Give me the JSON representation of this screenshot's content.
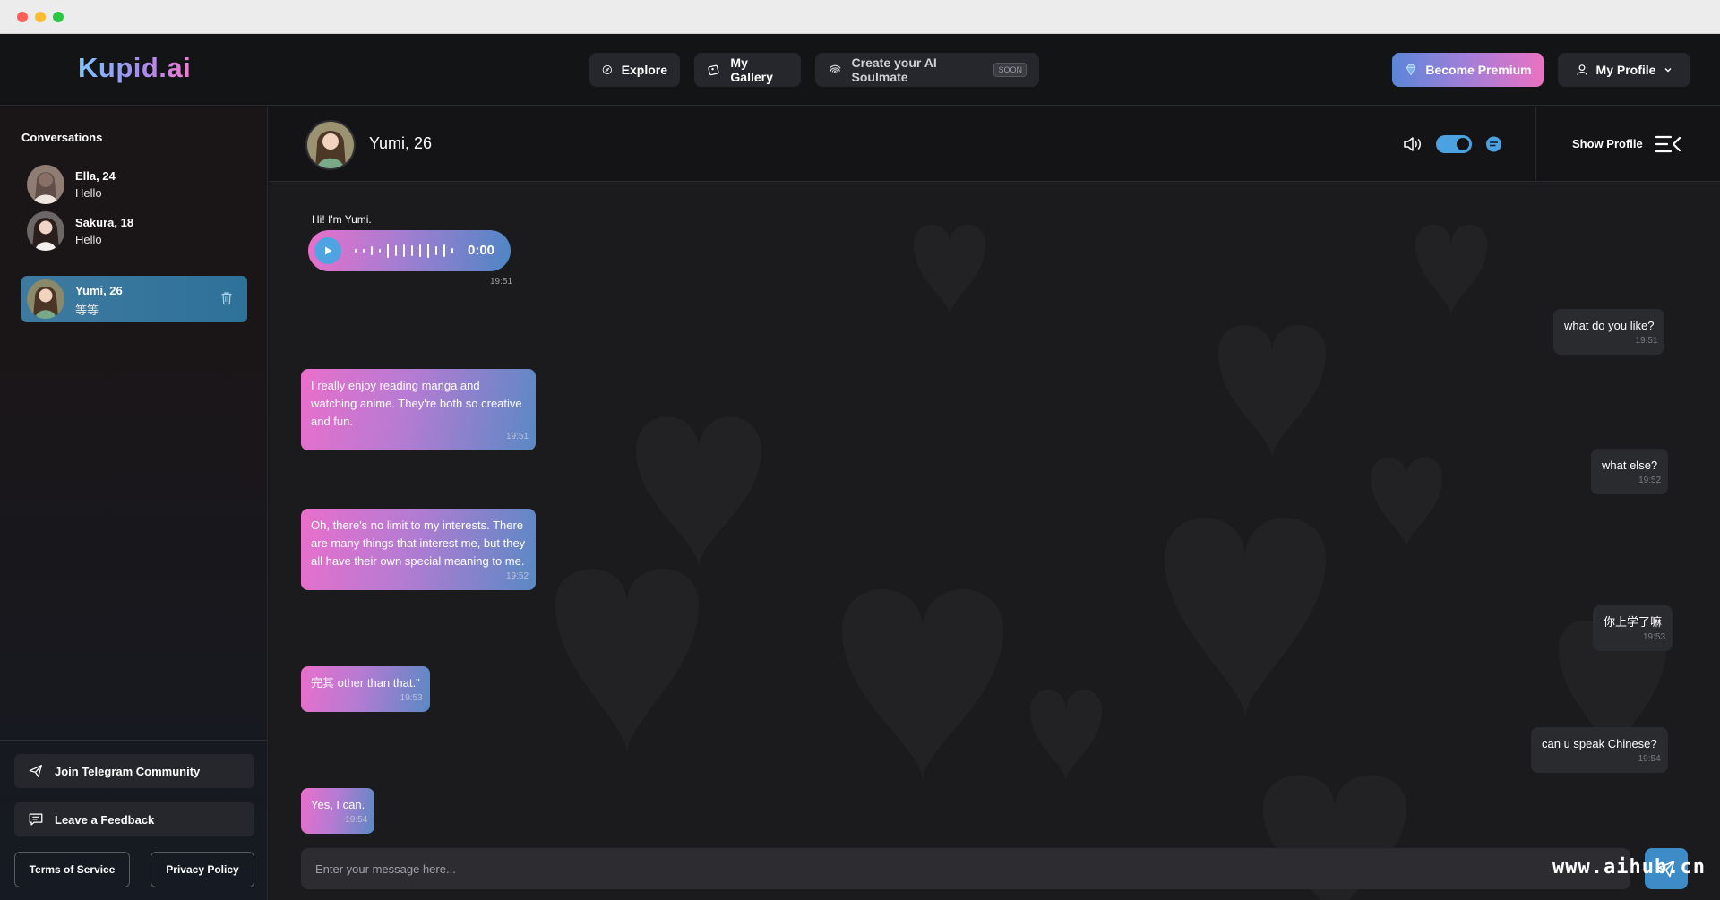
{
  "app": {
    "logo": "Kupid.ai"
  },
  "nav": {
    "explore": "Explore",
    "gallery": "My Gallery",
    "create": "Create your AI Soulmate",
    "create_badge": "SOON",
    "premium": "Become Premium",
    "profile": "My Profile"
  },
  "sidebar": {
    "title": "Conversations",
    "conversations": [
      {
        "name": "Ella, 24",
        "preview": "Hello",
        "active": false
      },
      {
        "name": "Sakura, 18",
        "preview": "Hello",
        "active": false
      },
      {
        "name": "Yumi, 26",
        "preview": "等等",
        "active": true
      }
    ],
    "telegram": "Join Telegram Community",
    "feedback": "Leave a Feedback",
    "terms": "Terms of Service",
    "privacy": "Privacy Policy"
  },
  "chat": {
    "name": "Yumi, 26",
    "show_profile": "Show Profile",
    "voice_toggle": true,
    "audio": {
      "label": "Hi! I'm Yumi.",
      "duration": "0:00",
      "time": "19:51"
    },
    "messages": [
      {
        "from": "user",
        "text": "what do you like?",
        "time": "19:51"
      },
      {
        "from": "bot",
        "text": "I really enjoy reading manga and watching anime. They're both so creative and fun.",
        "time": "19:51"
      },
      {
        "from": "user",
        "text": "what else?",
        "time": "19:52"
      },
      {
        "from": "bot",
        "text": "Oh, there's no limit to my interests. There are many things that interest me, but they all have their own special meaning to me.",
        "time": "19:52"
      },
      {
        "from": "user",
        "text": "你上学了嘛",
        "time": "19:53"
      },
      {
        "from": "bot",
        "text": "完其 other than that.\"",
        "time": "19:53"
      },
      {
        "from": "user",
        "text": "can u speak Chinese?",
        "time": "19:54"
      },
      {
        "from": "bot",
        "text": "Yes, I can.",
        "time": "19:54"
      }
    ],
    "input_placeholder": "Enter your message here..."
  },
  "watermark": "www.aihub.cn",
  "colors": {
    "accent_blue": "#3d8cc8",
    "pink": "#e96fcb",
    "active_conv": "#3e7aa0"
  }
}
